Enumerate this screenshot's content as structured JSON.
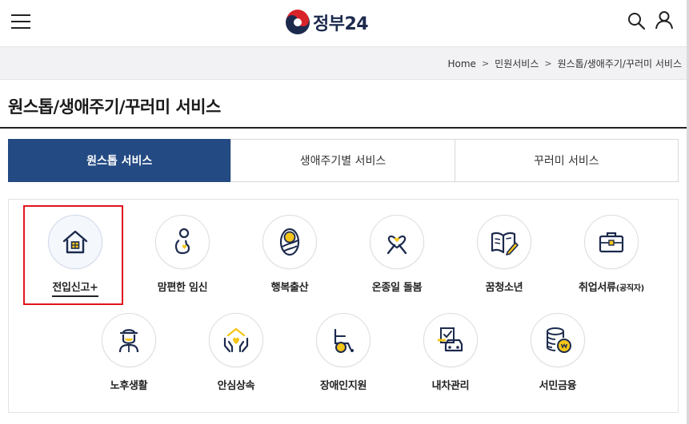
{
  "header": {
    "logo_text": "정부24",
    "logo_icon": "taegeuk-emblem",
    "menu_icon": "hamburger-menu-icon",
    "search_icon": "search-icon",
    "user_icon": "user-icon"
  },
  "breadcrumb": {
    "items": [
      "Home",
      "민원서비스",
      "원스톱/생애주기/꾸러미 서비스"
    ],
    "separator": ">"
  },
  "page_title": "원스톱/생애주기/꾸러미 서비스",
  "tabs": [
    {
      "label": "원스톱 서비스",
      "active": true
    },
    {
      "label": "생애주기별 서비스",
      "active": false
    },
    {
      "label": "꾸러미 서비스",
      "active": false
    }
  ],
  "services": [
    {
      "label": "전입신고+",
      "icon": "house-icon"
    },
    {
      "label": "맘편한 임신",
      "icon": "pregnant-woman-icon"
    },
    {
      "label": "행복출산",
      "icon": "swaddled-baby-icon"
    },
    {
      "label": "온종일 돌봄",
      "icon": "ribbon-heart-icon"
    },
    {
      "label": "꿈청소년",
      "icon": "open-book-pen-icon"
    },
    {
      "label": "취업서류",
      "label_suffix": "(공직자)",
      "icon": "briefcase-icon"
    },
    {
      "label": "노후생활",
      "icon": "elderly-man-icon"
    },
    {
      "label": "안심상속",
      "icon": "hands-heart-icon"
    },
    {
      "label": "장애인지원",
      "icon": "wheelchair-icon"
    },
    {
      "label": "내차관리",
      "icon": "car-checklist-icon"
    },
    {
      "label": "서민금융",
      "icon": "coins-icon"
    }
  ],
  "colors": {
    "active_tab": "#234a82",
    "icon_navy": "#1c2a4d",
    "icon_yellow": "#f5c518",
    "highlight_box": "#e0141e"
  }
}
